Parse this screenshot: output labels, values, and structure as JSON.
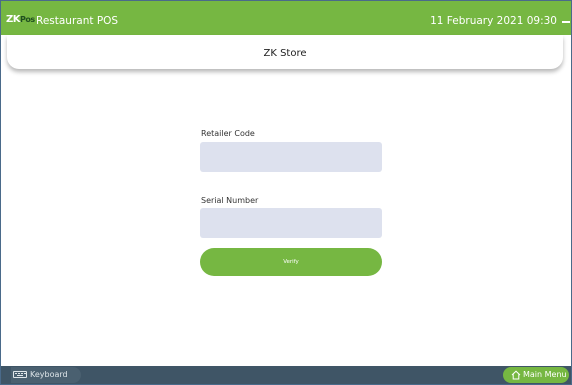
{
  "header": {
    "logo_zk": "ZK",
    "logo_pos": "Pos",
    "app_title": "Restaurant POS",
    "datetime": "11 February 2021 09:30"
  },
  "store": {
    "title": "ZK Store"
  },
  "form": {
    "retailer_code_label": "Retailer Code",
    "retailer_code_value": "",
    "serial_number_label": "Serial Number",
    "serial_number_value": "",
    "verify_label": "Verify"
  },
  "footer": {
    "keyboard_label": "Keyboard",
    "main_menu_label": "Main Menu"
  },
  "colors": {
    "accent_green": "#76b742",
    "input_bg": "#dde1ee",
    "footer_bg": "#3f5566"
  },
  "icons": {
    "keyboard": "keyboard-icon",
    "home": "home-icon",
    "minimize": "minimize-icon"
  }
}
